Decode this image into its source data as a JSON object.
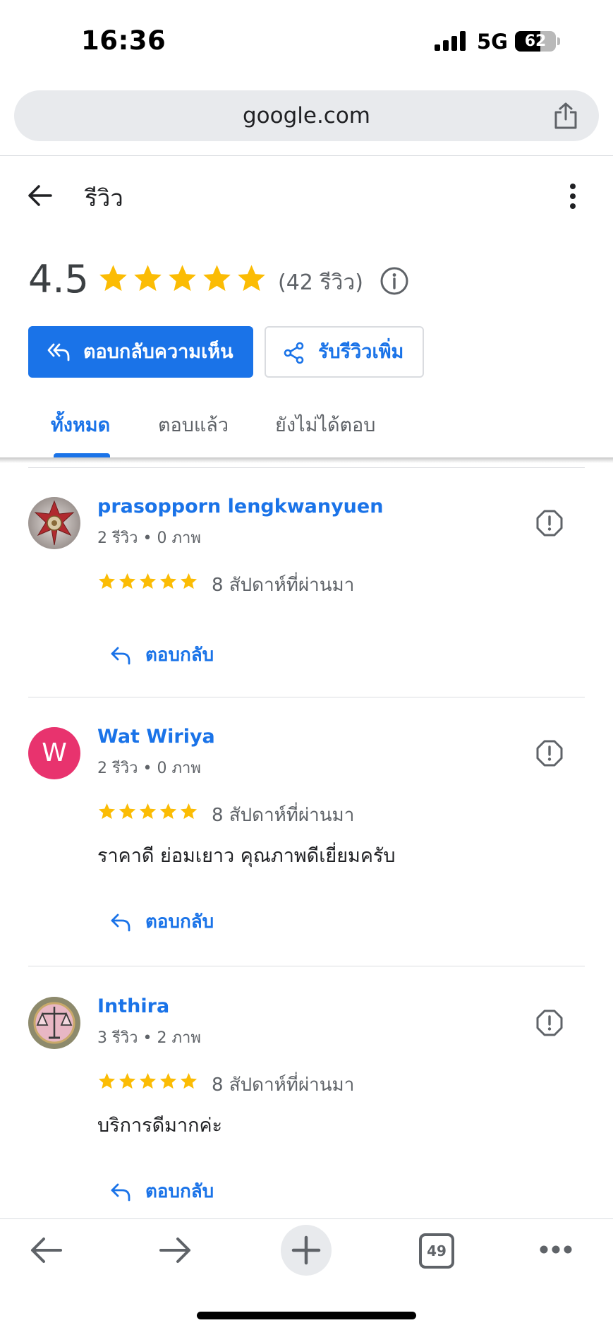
{
  "status_bar": {
    "time": "16:36",
    "network": "5G",
    "battery_level": "62"
  },
  "browser": {
    "url": "google.com"
  },
  "header": {
    "title": "รีวิว"
  },
  "summary": {
    "rating": "4.5",
    "stars": 5,
    "count_text": "(42 รีวิว)"
  },
  "actions": {
    "reply_label": "ตอบกลับความเห็น",
    "get_reviews_label": "รับรีวิวเพิ่ม"
  },
  "tabs": [
    {
      "label": "ทั้งหมด",
      "active": true
    },
    {
      "label": "ตอบแล้ว",
      "active": false
    },
    {
      "label": "ยังไม่ได้ตอบ",
      "active": false
    }
  ],
  "reviews": [
    {
      "name": "prasopporn lengkwanyuen",
      "meta": "2 รีวิว • 0 ภาพ",
      "stars": 5,
      "date": "8 สัปดาห์ที่ผ่านมา",
      "text": "",
      "reply_label": "ตอบกลับ",
      "avatar": "emblem-image"
    },
    {
      "name": "Wat Wiriya",
      "meta": "2 รีวิว • 0 ภาพ",
      "stars": 5,
      "date": "8 สัปดาห์ที่ผ่านมา",
      "text": "ราคาดี ย่อมเยาว คุณภาพดีเยี่ยมครับ",
      "reply_label": "ตอบกลับ",
      "avatar_letter": "W"
    },
    {
      "name": "Inthira",
      "meta": "3 รีวิว • 2 ภาพ",
      "stars": 5,
      "date": "8 สัปดาห์ที่ผ่านมา",
      "text": "บริการดีมากค่ะ",
      "reply_label": "ตอบกลับ",
      "avatar": "scales-image"
    }
  ],
  "toolbar": {
    "tab_count": "49"
  },
  "colors": {
    "accent": "#1a73e8",
    "star": "#fbbc04",
    "avatar_w": "#e8336e"
  }
}
